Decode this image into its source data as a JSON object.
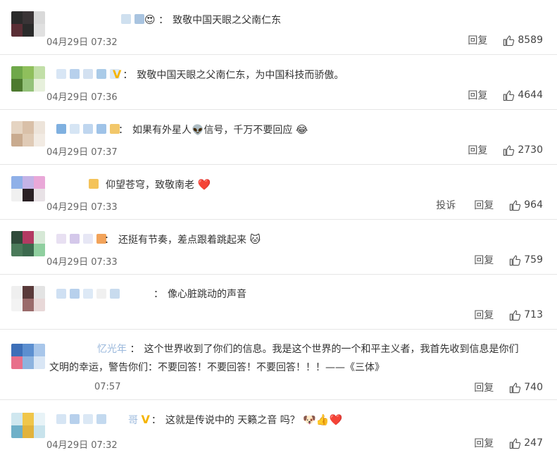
{
  "comments": [
    {
      "text": "致敬中国天眼之父南仁东",
      "emoji": "😍",
      "time": "04月29日 07:32",
      "reply": "回复",
      "likes": "8589"
    },
    {
      "text": "致敬中国天眼之父南仁东，为中国科技而骄傲。",
      "time": "04月29日 07:36",
      "reply": "回复",
      "likes": "4644"
    },
    {
      "text": "如果有外星人👽信号，千万不要回应",
      "emoji": "😂",
      "time": "04月29日 07:37",
      "reply": "回复",
      "likes": "2730"
    },
    {
      "text": "仰望苍穹，致敬南老",
      "emoji": "❤️",
      "time": "04月29日 07:33",
      "report": "投诉",
      "reply": "回复",
      "likes": "964"
    },
    {
      "text": "还挺有节奏，差点跟着跳起来",
      "emoji": "🐱",
      "time": "04月29日 07:33",
      "reply": "回复",
      "likes": "759"
    },
    {
      "text": "像心脏跳动的声音",
      "time": "",
      "reply": "回复",
      "likes": "713"
    },
    {
      "username_partial": "忆光年",
      "text_line1": "这个世界收到了你们的信息。我是这个世界的一个和平主义者，我首先收到信息是你们",
      "text_line2": "文明的幸运，警告你们：不要回答！不要回答！不要回答！！！——《三体》",
      "time": "07:57",
      "reply": "回复",
      "likes": "740"
    },
    {
      "username_partial": "哥",
      "text": "这就是传说中的 天籁之音 吗？",
      "emoji": "🐶👍❤️",
      "time": "04月29日 07:32",
      "reply": "回复",
      "likes": "247"
    }
  ],
  "colors": {
    "accent": "#f5b400",
    "divider": "#e6e6e6",
    "time": "#666666"
  },
  "icons": {
    "like": "thumbs-up-icon",
    "vip": "v-badge-icon"
  }
}
